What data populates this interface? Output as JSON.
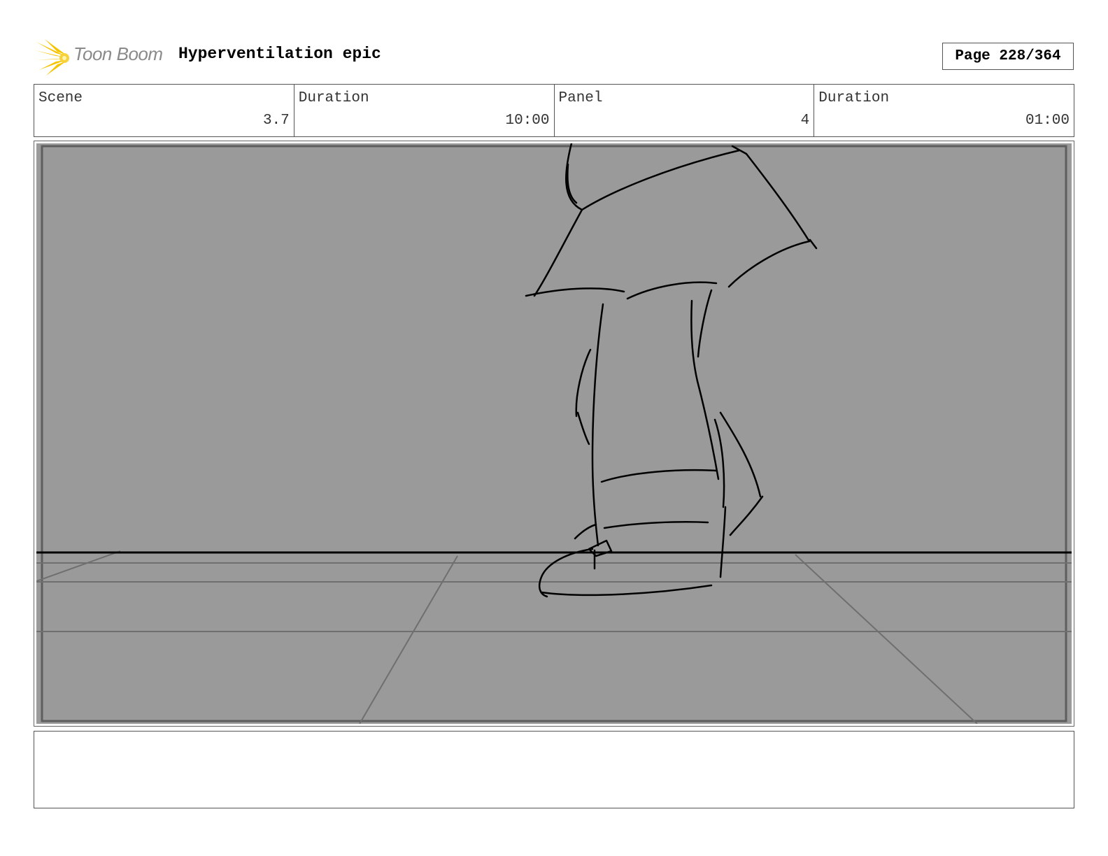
{
  "header": {
    "logo_text": "Toon Boom",
    "project_title": "Hyperventilation epic",
    "page_indicator": "Page 228/364"
  },
  "info": {
    "scene_label": "Scene",
    "scene_value": "3.7",
    "scene_duration_label": "Duration",
    "scene_duration_value": "10:00",
    "panel_label": "Panel",
    "panel_value": "4",
    "panel_duration_label": "Duration",
    "panel_duration_value": "01:00"
  },
  "colors": {
    "panel_background": "#9a9a9a",
    "logo_accent": "#f5c400",
    "sketch_line": "#000000"
  },
  "panel": {
    "description_icon": "storyboard-sketch-legs-walking"
  },
  "notes": {
    "text": ""
  }
}
